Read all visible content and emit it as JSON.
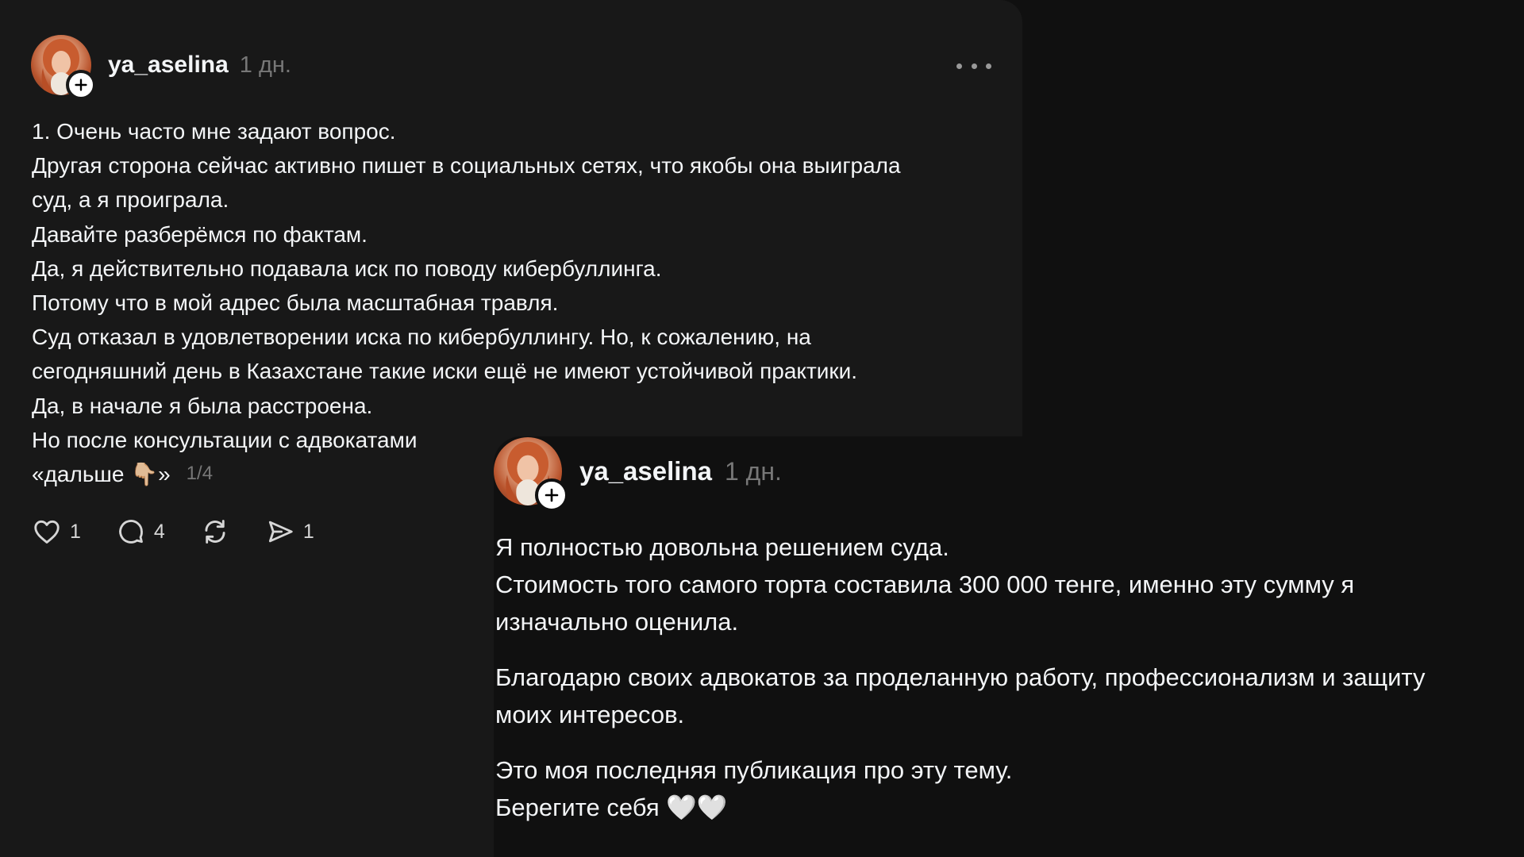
{
  "post": {
    "username": "ya_aselina",
    "time": "1 дн.",
    "body_lines": [
      "1. Очень часто мне задают вопрос.",
      "Другая сторона сейчас активно пишет в социальных сетях, что якобы она выиграла",
      "суд, а я проиграла.",
      "Давайте разберёмся по фактам.",
      "Да, я действительно подавала иск по поводу кибербуллинга.",
      "Потому что в мой адрес была масштабная травля.",
      "Суд отказал в удовлетворении иска по кибербуллингу. Но, к сожалению, на",
      "сегодняшний день в Казахстане такие иски ещё не имеют устойчивой практики.",
      "Да, в начале я была расстроена.",
      "Но после консультации с адвокатами"
    ],
    "last_line": "«дальше 👇🏼»",
    "page_counter": "1/4",
    "actions": {
      "like_count": "1",
      "comment_count": "4",
      "share_count": "1"
    },
    "icons": {
      "more": "more-horizontal-icon",
      "like": "heart-icon",
      "comment": "comment-icon",
      "repost": "repost-icon",
      "share": "send-icon",
      "follow": "plus-icon"
    }
  },
  "overlay_post": {
    "username": "ya_aselina",
    "time": "1 дн.",
    "paragraphs": [
      [
        "Я полностью довольна решением суда.",
        "Стоимость того самого торта составила 300 000 тенге, именно эту сумму я",
        "изначально оценила."
      ],
      [
        "Благодарю своих адвокатов за проделанную работу, профессионализм и защиту",
        "моих интересов."
      ],
      [
        "Это моя последняя публикация про эту тему.",
        "Берегите себя 🤍🤍"
      ]
    ]
  },
  "colors": {
    "background": "#101010",
    "card": "#181818",
    "text": "#f3f5f7",
    "muted": "#777777"
  }
}
